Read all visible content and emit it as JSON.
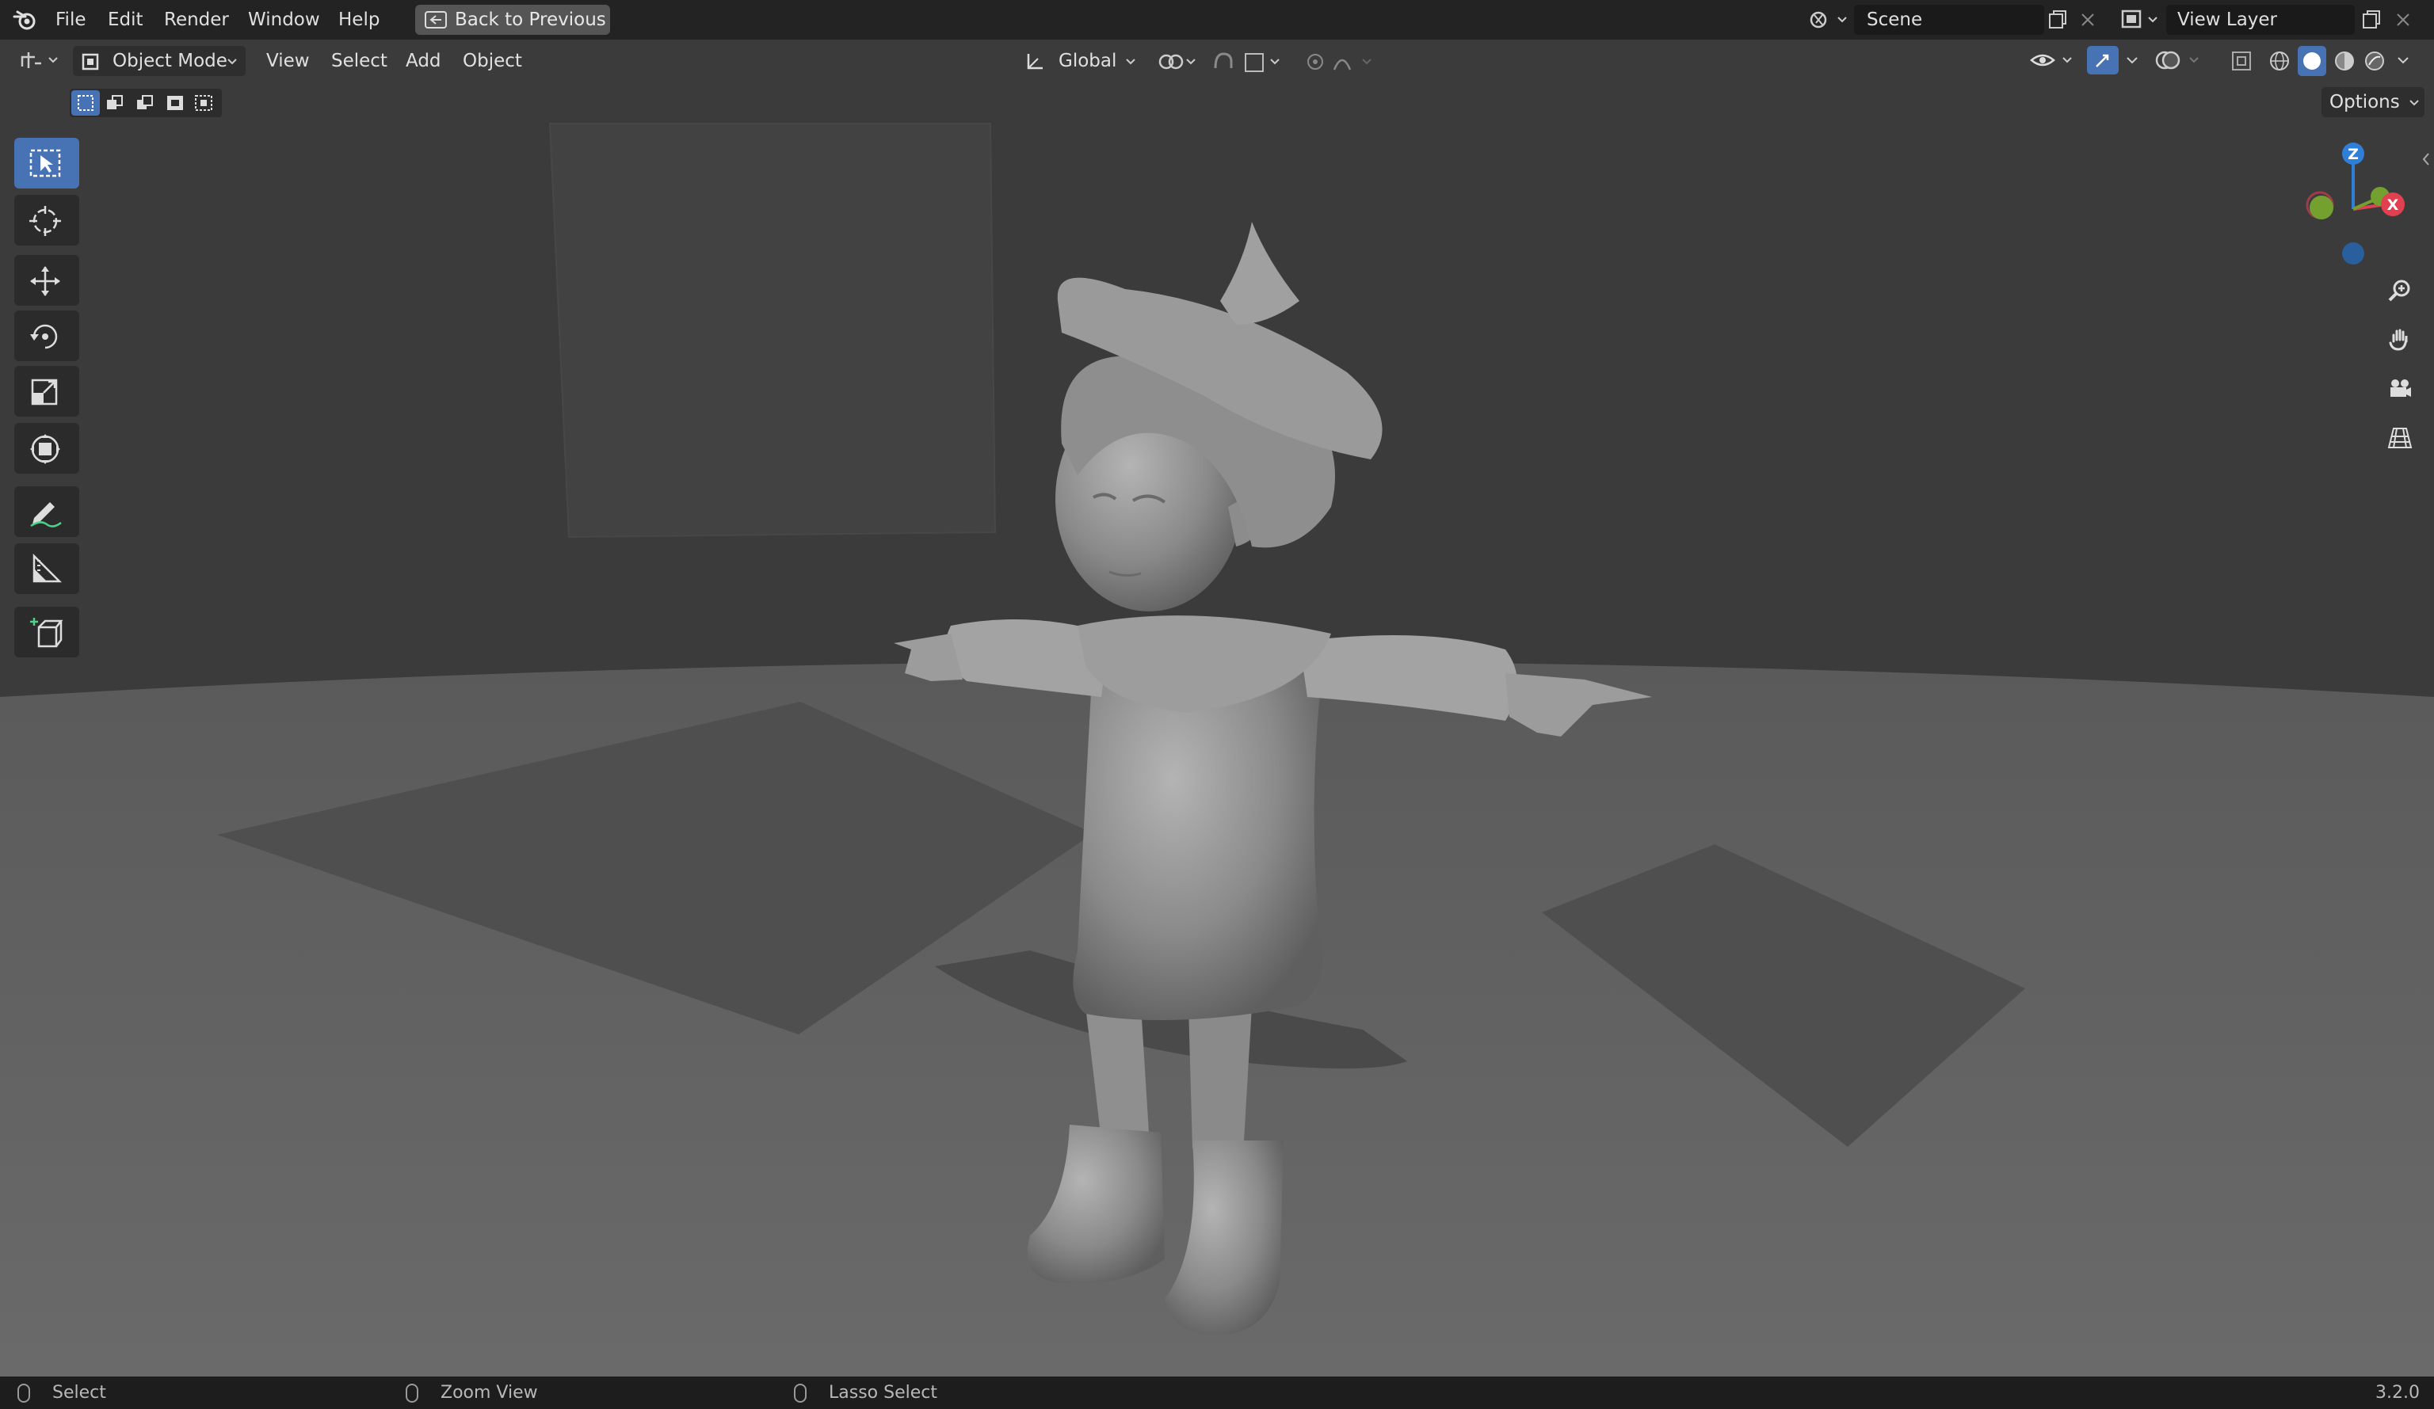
{
  "menu": {
    "file": "File",
    "edit": "Edit",
    "render": "Render",
    "window": "Window",
    "help": "Help",
    "back_to_previous": "Back to Previous"
  },
  "scene": {
    "label": "Scene"
  },
  "view_layer": {
    "label": "View Layer"
  },
  "viewport_header": {
    "mode": "Object Mode",
    "view": "View",
    "select": "Select",
    "add": "Add",
    "object": "Object",
    "orientation": "Global",
    "options": "Options"
  },
  "gizmo": {
    "z": "Z",
    "x": "X"
  },
  "statusbar": {
    "select": "Select",
    "zoom_view": "Zoom View",
    "lasso_select": "Lasso Select",
    "version": "3.2.0"
  },
  "icons": [
    "blender-logo-icon",
    "editor-type-icon",
    "object-mode-icon",
    "transform-orientation-icon",
    "pivot-icon",
    "snap-icon",
    "proportional-edit-icon",
    "visibility-icon",
    "gizmo-icon",
    "overlay-icon",
    "xray-icon",
    "wireframe-shading-icon",
    "solid-shading-icon",
    "material-shading-icon",
    "rendered-shading-icon",
    "select-box-icon",
    "cursor-icon",
    "move-icon",
    "rotate-icon",
    "scale-icon",
    "transform-icon",
    "annotate-icon",
    "measure-icon",
    "add-cube-icon",
    "zoom-icon",
    "hand-pan-icon",
    "camera-icon",
    "grid-icon"
  ],
  "colors": {
    "accent": "#4772b3",
    "axis_x": "#e04050",
    "axis_y": "#74a030",
    "axis_z": "#2f7fd8"
  }
}
